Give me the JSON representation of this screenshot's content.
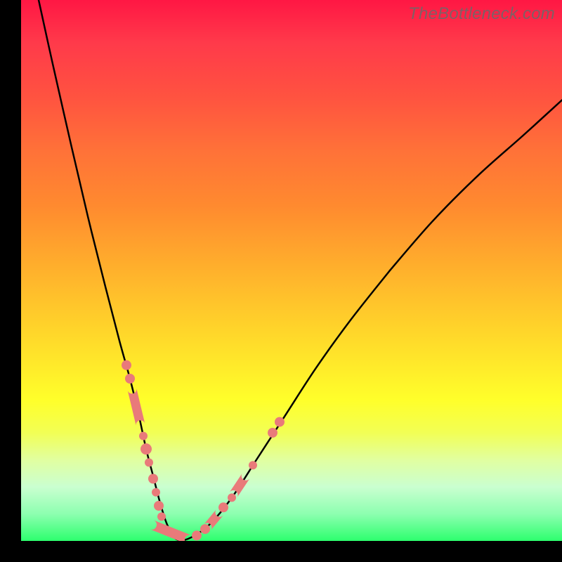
{
  "watermark": "TheBottleneck.com",
  "chart_data": {
    "type": "line",
    "title": "",
    "xlabel": "",
    "ylabel": "",
    "xlim": [
      0,
      770
    ],
    "ylim_bottleneck_pct": [
      0,
      100
    ],
    "gradient_legend_implied": {
      "top_color": "#ff1744",
      "bottom_color": "#2dff6e",
      "meaning": "background color encodes bottleneck percentage; red=high, green=0%"
    },
    "series": [
      {
        "name": "bottleneck-curve",
        "note": "V-shaped curve; y is fraction of chart height from top (0=top,1=bottom)",
        "x": [
          25,
          45,
          70,
          95,
          120,
          140,
          155,
          168,
          178,
          188,
          198,
          208,
          220,
          238,
          268,
          300,
          335,
          375,
          420,
          470,
          525,
          585,
          650,
          715,
          770
        ],
        "y": [
          0.0,
          0.118,
          0.261,
          0.4,
          0.53,
          0.63,
          0.7,
          0.77,
          0.83,
          0.88,
          0.93,
          0.97,
          0.996,
          0.996,
          0.97,
          0.92,
          0.85,
          0.77,
          0.68,
          0.59,
          0.5,
          0.41,
          0.325,
          0.25,
          0.185
        ]
      }
    ],
    "markers_on_curve": [
      {
        "type": "dot",
        "x": 150,
        "y": 0.675,
        "r": 7
      },
      {
        "type": "dot",
        "x": 155,
        "y": 0.7,
        "r": 7
      },
      {
        "type": "band",
        "x1": 158,
        "y1": 0.72,
        "x2": 170,
        "y2": 0.785,
        "w": 13
      },
      {
        "type": "dot",
        "x": 174,
        "y": 0.806,
        "r": 6
      },
      {
        "type": "dot",
        "x": 178,
        "y": 0.83,
        "r": 8
      },
      {
        "type": "dot",
        "x": 182,
        "y": 0.855,
        "r": 6
      },
      {
        "type": "band",
        "x1": 186,
        "y1": 0.97,
        "x2": 240,
        "y2": 0.998,
        "w": 14
      },
      {
        "type": "dot",
        "x": 188,
        "y": 0.885,
        "r": 7
      },
      {
        "type": "dot",
        "x": 192,
        "y": 0.91,
        "r": 6
      },
      {
        "type": "dot",
        "x": 196,
        "y": 0.935,
        "r": 7
      },
      {
        "type": "dot",
        "x": 200,
        "y": 0.955,
        "r": 6
      },
      {
        "type": "dot",
        "x": 250,
        "y": 0.99,
        "r": 7
      },
      {
        "type": "dot",
        "x": 262,
        "y": 0.978,
        "r": 7
      },
      {
        "type": "band",
        "x1": 265,
        "y1": 0.975,
        "x2": 283,
        "y2": 0.947,
        "w": 13
      },
      {
        "type": "dot",
        "x": 288,
        "y": 0.938,
        "r": 7
      },
      {
        "type": "dot",
        "x": 300,
        "y": 0.92,
        "r": 6
      },
      {
        "type": "band",
        "x1": 302,
        "y1": 0.915,
        "x2": 320,
        "y2": 0.88,
        "w": 13
      },
      {
        "type": "dot",
        "x": 330,
        "y": 0.86,
        "r": 6
      },
      {
        "type": "dot",
        "x": 358,
        "y": 0.8,
        "r": 7
      },
      {
        "type": "dot",
        "x": 368,
        "y": 0.78,
        "r": 7
      }
    ]
  }
}
